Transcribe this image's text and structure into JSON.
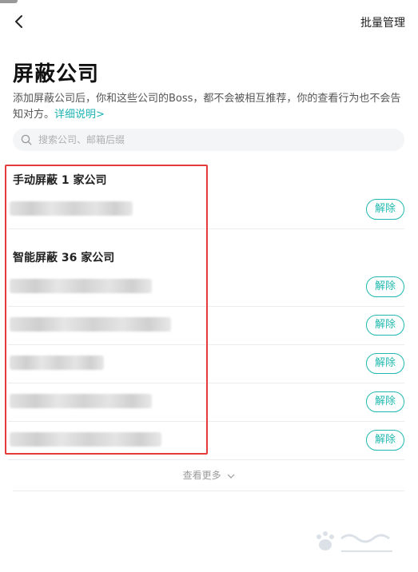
{
  "topbar": {
    "batch_manage": "批量管理"
  },
  "page": {
    "title": "屏蔽公司",
    "description": "添加屏蔽公司后，你和这些公司的Boss，都不会被相互推荐，你的查看行为也不会告知对方。",
    "detail_link": "详细说明>"
  },
  "search": {
    "placeholder": "搜索公司、邮箱后缀"
  },
  "manual_section": {
    "title": "手动屏蔽 1 家公司",
    "count": 1
  },
  "smart_section": {
    "title": "智能屏蔽 36 家公司",
    "count": 36
  },
  "unblock_label": "解除",
  "more_label": "查看更多",
  "colors": {
    "accent": "#20b9b0",
    "highlight_box": "#e53b3b"
  },
  "icons": {
    "back": "chevron-left-icon",
    "search": "search-icon",
    "more": "chevron-down-icon"
  }
}
